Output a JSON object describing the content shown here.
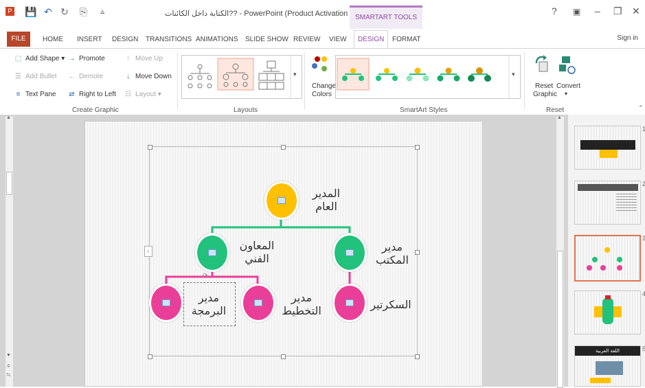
{
  "window": {
    "title": "الكتابة داخل الكائنات?? - PowerPoint (Product Activation Failed)",
    "context_tools": "SMARTART TOOLS",
    "help": "?",
    "signin": "Sign in"
  },
  "tabs": [
    "FILE",
    "HOME",
    "INSERT",
    "DESIGN",
    "TRANSITIONS",
    "ANIMATIONS",
    "SLIDE SHOW",
    "REVIEW",
    "VIEW",
    "DESIGN",
    "FORMAT"
  ],
  "ribbon": {
    "create_graphic": {
      "add_shape": "Add Shape",
      "add_bullet": "Add Bullet",
      "text_pane": "Text Pane",
      "promote": "Promote",
      "demote": "Demote",
      "right_to_left": "Right to Left",
      "move_up": "Move Up",
      "move_down": "Move Down",
      "layout": "Layout",
      "label": "Create Graphic"
    },
    "layouts": {
      "label": "Layouts"
    },
    "smartart_styles": {
      "change_colors_1": "Change",
      "change_colors_2": "Colors",
      "label": "SmartArt Styles"
    },
    "reset": {
      "reset_graphic_1": "Reset",
      "reset_graphic_2": "Graphic",
      "convert": "Convert",
      "label": "Reset"
    }
  },
  "org_chart": {
    "top": "المدير العام",
    "mid_left": "المعاون الفني",
    "mid_right": "مدير المكتب",
    "bot_1": "مدير البرمجة",
    "bot_2": "مدير التخطيط",
    "bot_3": "السكرتير"
  },
  "colors": {
    "accent": "#8d4ca5",
    "file_tab": "#b7472a",
    "node_top": "#ffc000",
    "node_mid": "#22c27d",
    "node_bot": "#ea3f98",
    "connector_green": "#22c27d",
    "connector_pink": "#ea3f98"
  },
  "thumbnails": {
    "numbers": [
      "1",
      "2",
      "3",
      "4",
      "5"
    ],
    "slide5_title": "اللغة العربية"
  }
}
